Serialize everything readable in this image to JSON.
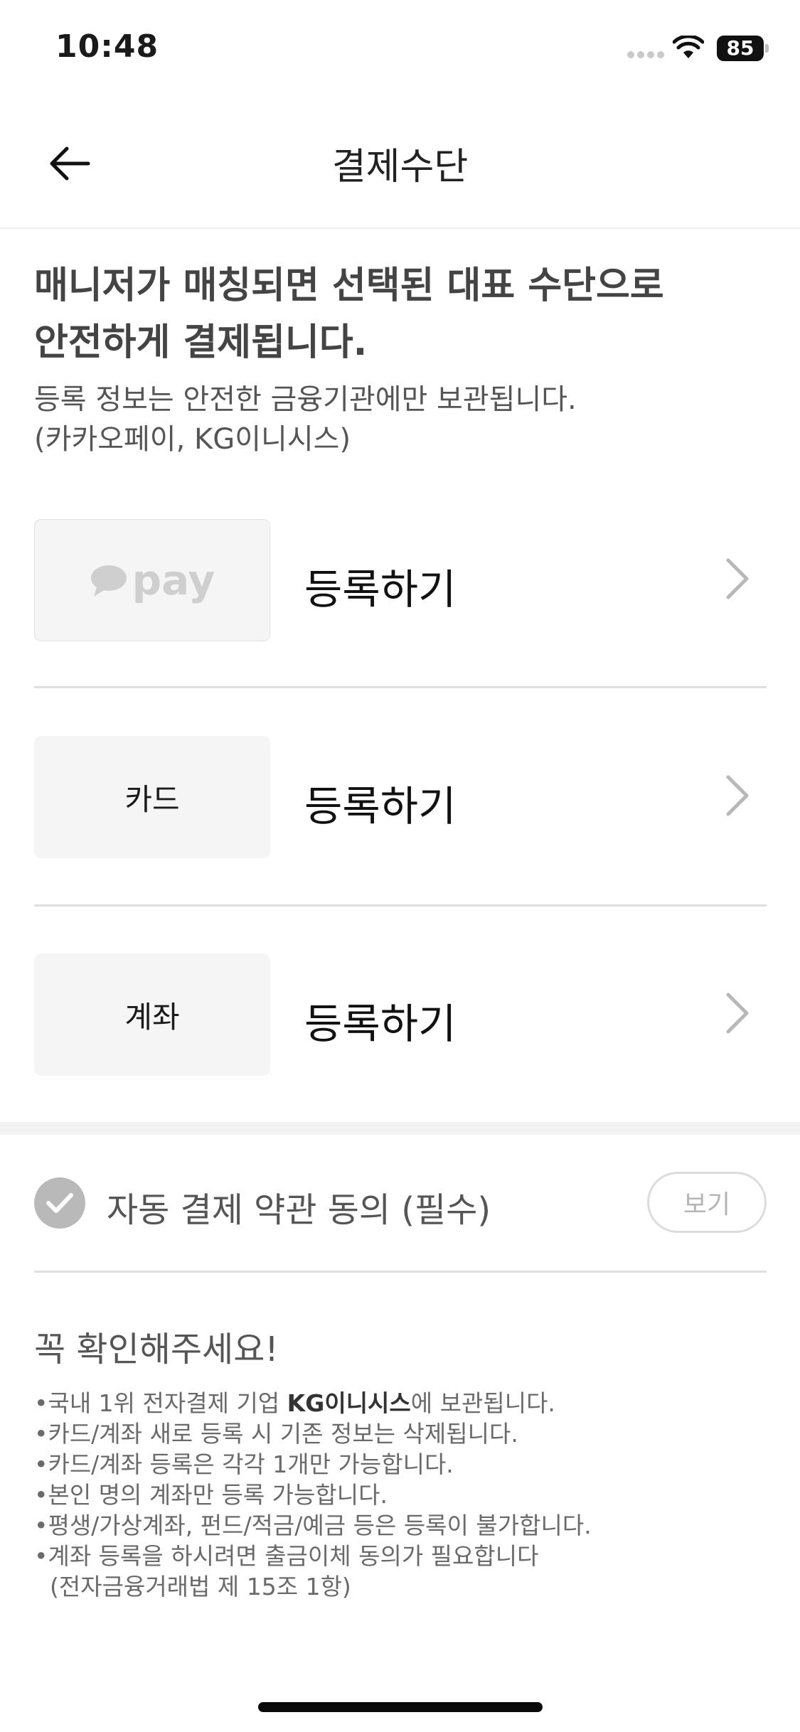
{
  "status_bar": {
    "time": "10:48",
    "battery": "85"
  },
  "header": {
    "title": "결제수단",
    "back_icon": "arrow-left-icon"
  },
  "intro": {
    "headline_line1": "매니저가 매칭되면 선택된 대표 수단으로",
    "headline_line2": "안전하게 결제됩니다.",
    "sub_line1": "등록 정보는 안전한 금융기관에만 보관됩니다.",
    "sub_line2": "(카카오페이, KG이니시스)"
  },
  "methods": [
    {
      "logo_text": "pay",
      "logo_icon": "kakao-speech-bubble-icon",
      "action": "등록하기"
    },
    {
      "logo_text": "카드",
      "action": "등록하기"
    },
    {
      "logo_text": "계좌",
      "action": "등록하기"
    }
  ],
  "agreement": {
    "label": "자동 결제 약관 동의 (필수)",
    "view_button": "보기",
    "checked": true
  },
  "notice": {
    "title": "꼭 확인해주세요!",
    "items": [
      {
        "prefix": "•국내 1위 전자결제 기업 ",
        "strong": "KG이니시스",
        "suffix": "에 보관됩니다."
      },
      "•카드/계좌 새로 등록 시 기존 정보는 삭제됩니다.",
      "•카드/계좌 등록은 각각 1개만 가능합니다.",
      "•본인 명의 계좌만 등록 가능합니다.",
      "•평생/가상계좌, 펀드/적금/예금 등은 등록이 불가합니다.",
      "•계좌 등록을 하시려면 출금이체 동의가 필요합니다",
      "(전자금융거래법 제 15조 1항)"
    ]
  },
  "colors": {
    "text": "#1a1a1a",
    "muted": "#6a6a6a",
    "logo_bg": "#f5f5f5",
    "check": "#b9b9b9"
  }
}
